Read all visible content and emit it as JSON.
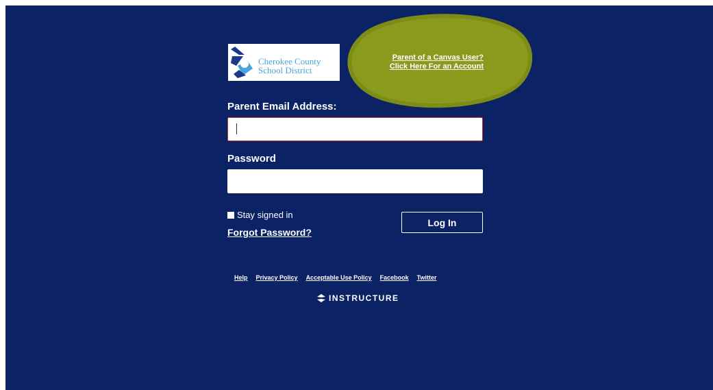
{
  "logo": {
    "line1": "Cherokee County",
    "line2": "School District"
  },
  "signup": {
    "line1": "Parent of a Canvas User?",
    "line2": "Click Here For an Account"
  },
  "form": {
    "email_label": "Parent Email Address:",
    "email_value": "",
    "password_label": "Password",
    "password_value": "",
    "stay_signed_in": "Stay signed in",
    "forgot_password": "Forgot Password?",
    "login_button": "Log In"
  },
  "footer": {
    "help": "Help",
    "privacy": "Privacy Policy",
    "acceptable_use": "Acceptable Use Policy",
    "facebook": "Facebook",
    "twitter": "Twitter",
    "brand": "INSTRUCTURE"
  },
  "colors": {
    "background": "#0b2265",
    "highlight": "#8a9a1c",
    "logo_text": "#4aa3d9",
    "input_error_border": "#c0392b"
  }
}
